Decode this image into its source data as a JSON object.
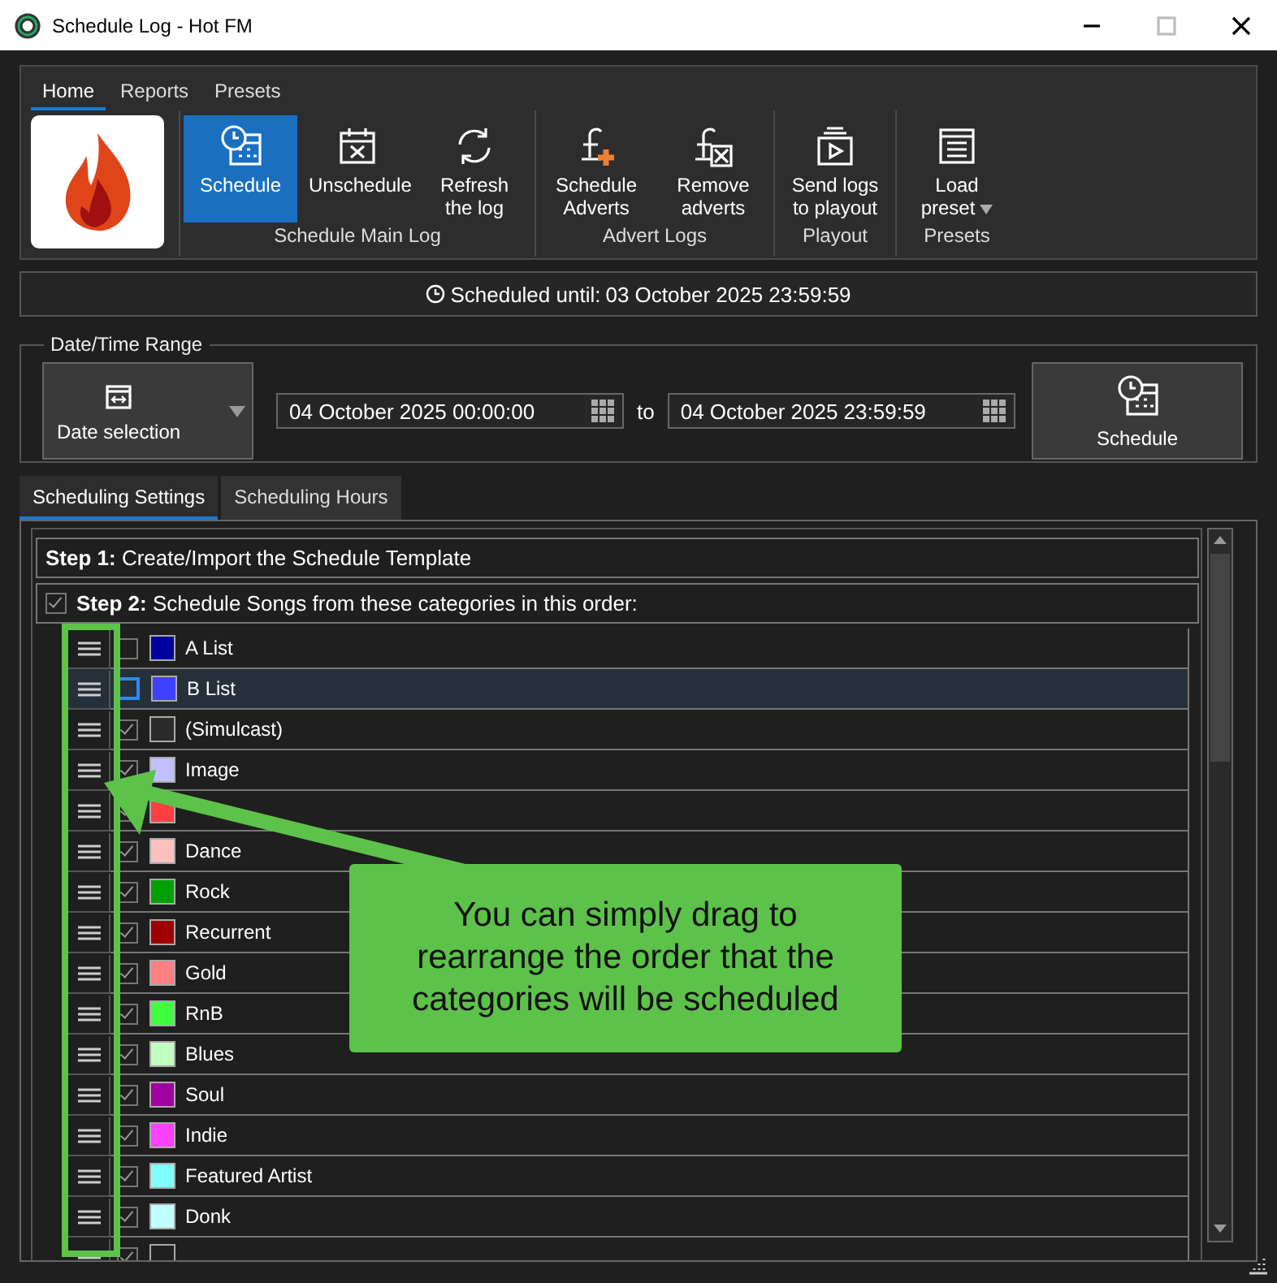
{
  "window": {
    "title": "Schedule Log - Hot FM"
  },
  "ribbon": {
    "tabs": [
      {
        "label": "Home",
        "selected": true
      },
      {
        "label": "Reports",
        "selected": false
      },
      {
        "label": "Presets",
        "selected": false
      }
    ],
    "groups": [
      {
        "label": "Schedule Main Log",
        "buttons": [
          {
            "kind": "schedule",
            "label": "Schedule",
            "selected": true
          },
          {
            "kind": "unschedule",
            "label": "Unschedule",
            "selected": false
          },
          {
            "kind": "refresh",
            "label": "Refresh the log",
            "selected": false
          }
        ]
      },
      {
        "label": "Advert Logs",
        "buttons": [
          {
            "kind": "add-advert",
            "label": "Schedule Adverts",
            "selected": false
          },
          {
            "kind": "remove-advert",
            "label": "Remove adverts",
            "selected": false
          }
        ]
      },
      {
        "label": "Playout",
        "buttons": [
          {
            "kind": "send",
            "label": "Send logs to playout",
            "selected": false
          }
        ]
      },
      {
        "label": "Presets",
        "buttons": [
          {
            "kind": "load",
            "label": "Load preset",
            "selected": false
          }
        ]
      }
    ]
  },
  "status": {
    "label": "Scheduled until:",
    "value": "03 October 2025 23:59:59"
  },
  "range": {
    "title": "Date/Time Range",
    "mode": "Date selection",
    "from": "04 October 2025 00:00:00",
    "separator": "to",
    "to": "04 October 2025 23:59:59",
    "button": "Schedule"
  },
  "tabs": [
    {
      "label": "Scheduling Settings",
      "selected": true
    },
    {
      "label": "Scheduling Hours",
      "selected": false
    }
  ],
  "step1": {
    "title": "Step 1:",
    "text": "Create/Import the Schedule Template"
  },
  "step2": {
    "title": "Step 2:",
    "text": "Schedule Songs from these categories in this order:",
    "checked": true
  },
  "categories": [
    {
      "name": "A List",
      "checked": false,
      "focused": false,
      "color": "#0000a0"
    },
    {
      "name": "B List",
      "checked": false,
      "focused": true,
      "color": "#4040ff"
    },
    {
      "name": "(Simulcast)",
      "checked": true,
      "focused": false,
      "color": "#2b2b2b"
    },
    {
      "name": "Image",
      "checked": true,
      "focused": false,
      "color": "#c0c0ff"
    },
    {
      "checked": true,
      "focused": false,
      "color": "#ff4040"
    },
    {
      "name": "Dance",
      "checked": true,
      "focused": false,
      "color": "#ffc0c0"
    },
    {
      "name": "Rock",
      "checked": true,
      "focused": false,
      "color": "#00a000"
    },
    {
      "name": "Recurrent",
      "checked": true,
      "focused": false,
      "color": "#a00000"
    },
    {
      "name": "Gold",
      "checked": true,
      "focused": false,
      "color": "#ff8080"
    },
    {
      "name": "RnB",
      "checked": true,
      "focused": false,
      "color": "#40ff40"
    },
    {
      "name": "Blues",
      "checked": true,
      "focused": false,
      "color": "#c0ffc0"
    },
    {
      "name": "Soul",
      "checked": true,
      "focused": false,
      "color": "#a000a0"
    },
    {
      "name": "Indie",
      "checked": true,
      "focused": false,
      "color": "#ff40ff"
    },
    {
      "name": "Featured Artist",
      "checked": true,
      "focused": false,
      "color": "#80ffff"
    },
    {
      "name": "Donk",
      "checked": true,
      "focused": false,
      "color": "#c0ffff"
    },
    {
      "checked": true,
      "focused": false,
      "color": "#202020"
    }
  ],
  "callout": {
    "text": "You can simply drag to rearrange the order that the categories will be scheduled"
  }
}
